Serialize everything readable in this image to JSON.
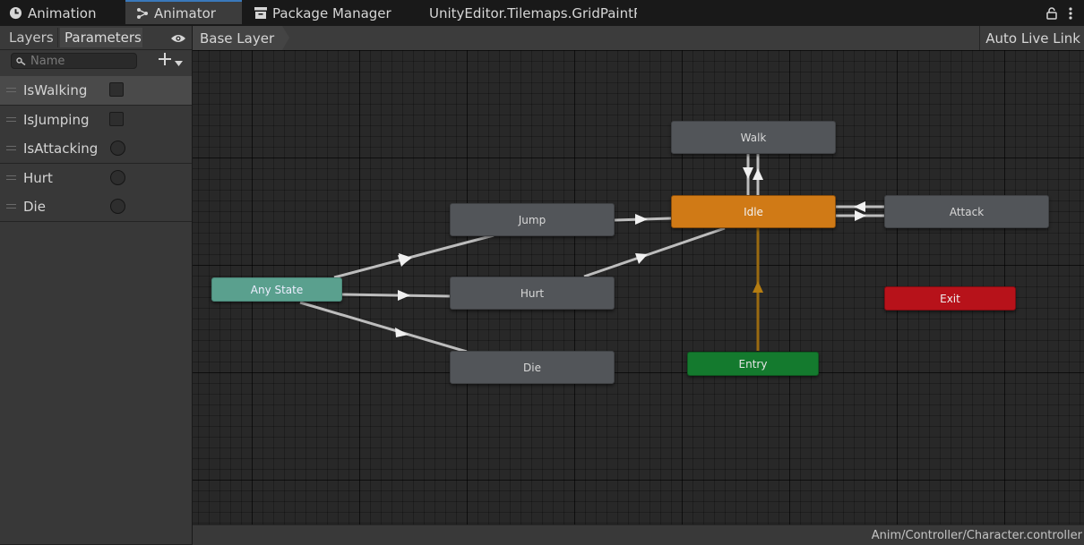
{
  "tabs": [
    {
      "label": "Animation",
      "icon": "clock-icon"
    },
    {
      "label": "Animator",
      "icon": "animator-icon"
    },
    {
      "label": "Package Manager",
      "icon": "package-icon"
    },
    {
      "label": "UnityEditor.Tilemaps.GridPaintPa"
    }
  ],
  "left_panel": {
    "tabs": [
      "Layers",
      "Parameters"
    ],
    "search_placeholder": "Name",
    "params": [
      {
        "name": "IsWalking",
        "type": "bool"
      },
      {
        "name": "IsJumping",
        "type": "bool"
      },
      {
        "name": "IsAttacking",
        "type": "trigger"
      },
      {
        "name": "Hurt",
        "type": "trigger"
      },
      {
        "name": "Die",
        "type": "trigger"
      }
    ]
  },
  "graph": {
    "breadcrumb": "Base Layer",
    "auto_live_link": "Auto Live Link",
    "states": {
      "walk": "Walk",
      "idle": "Idle",
      "attack": "Attack",
      "jump": "Jump",
      "hurt": "Hurt",
      "die": "Die",
      "any_state": "Any State",
      "entry": "Entry",
      "exit": "Exit"
    },
    "colors": {
      "idle_default": "#d07a16",
      "any_state": "#5aa08e",
      "entry": "#147a2e",
      "exit": "#b7121a",
      "transition": "#c8c8c8",
      "entry_transition": "#9a6a10"
    }
  },
  "status": {
    "asset_path": "Anim/Controller/Character.controller"
  }
}
